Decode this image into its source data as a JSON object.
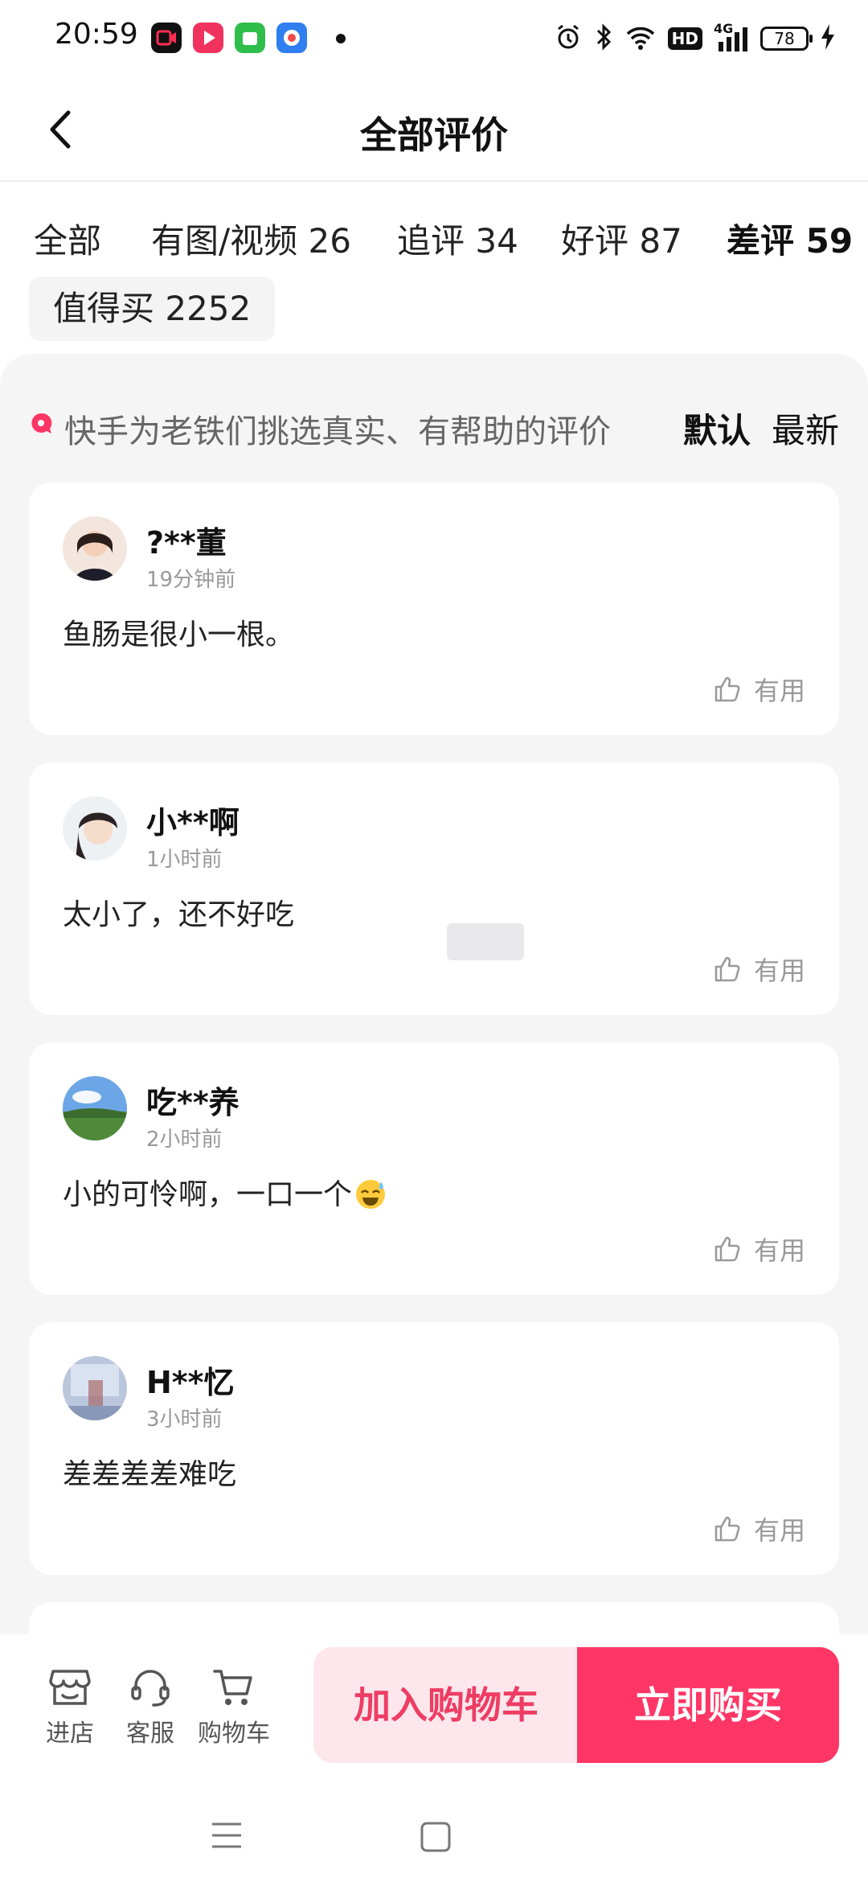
{
  "status": {
    "time": "20:59",
    "hd": "HD",
    "network": "4G",
    "battery": "78"
  },
  "header": {
    "title": "全部评价"
  },
  "filters": {
    "tabs": [
      {
        "label": "全部"
      },
      {
        "label": "有图/视频 26"
      },
      {
        "label": "追评 34"
      },
      {
        "label": "好评 87"
      },
      {
        "label": "差评 59"
      }
    ],
    "chip": "值得买 2252"
  },
  "review_header": {
    "tip": "快手为老铁们挑选真实、有帮助的评价",
    "sort_default": "默认",
    "sort_latest": "最新"
  },
  "reviews": [
    {
      "name": "?**董",
      "time": "19分钟前",
      "text": "鱼肠是很小一根。",
      "useful": "有用"
    },
    {
      "name": "小**啊",
      "time": "1小时前",
      "text": "太小了，还不好吃",
      "useful": "有用"
    },
    {
      "name": "吃**养",
      "time": "2小时前",
      "text": "小的可怜啊，一口一个",
      "useful": "有用"
    },
    {
      "name": "H**忆",
      "time": "3小时前",
      "text": "差差差差难吃",
      "useful": "有用"
    }
  ],
  "bottom": {
    "store": "进店",
    "service": "客服",
    "cart": "购物车",
    "add_to_cart": "加入购物车",
    "buy_now": "立即购买"
  },
  "colors": {
    "accent": "#fe3666",
    "accent_light": "#fde7ec",
    "background": "#f5f5f6"
  }
}
